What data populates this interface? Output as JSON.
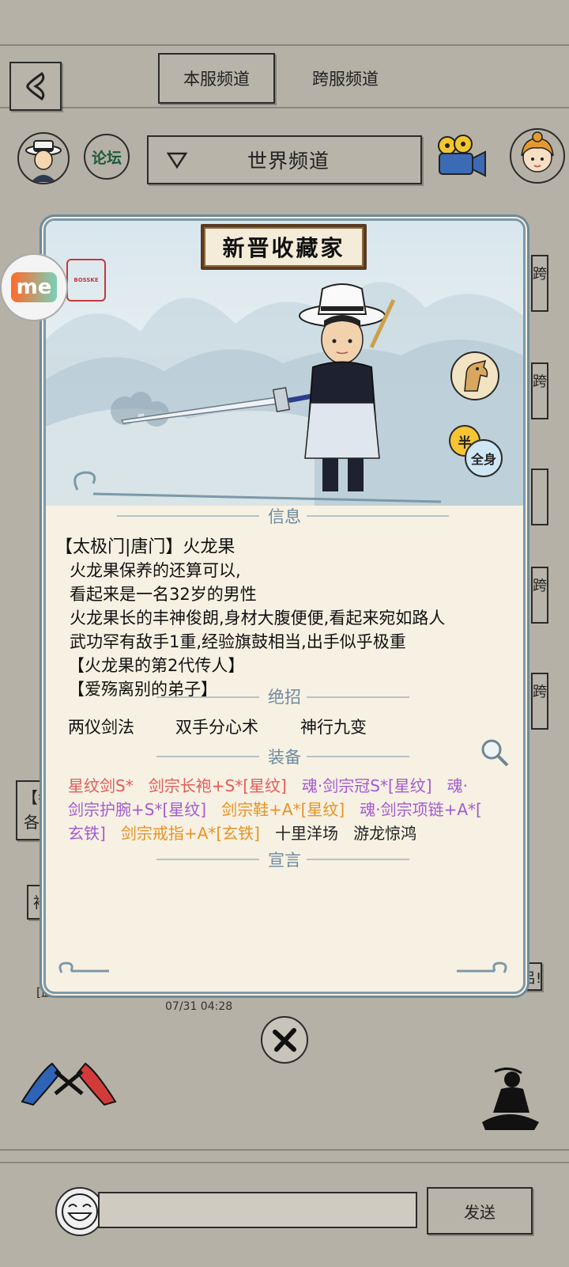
{
  "header": {
    "tabs": [
      {
        "label": "本服频道",
        "active": true
      },
      {
        "label": "跨服频道",
        "active": false
      }
    ]
  },
  "channel_bar": {
    "forum_label": "论坛",
    "channel_name": "世界频道"
  },
  "background_chat": {
    "fragment_1": "【孝",
    "fragment_2": "各",
    "fragment_3": "袖",
    "sender_fragment": "[血刀",
    "timestamp": "07/31 04:28",
    "side_char": "跨",
    "right_fragment": "吕!"
  },
  "profile": {
    "title": "新晋收藏家",
    "stance_buttons": [
      "半",
      "全身"
    ],
    "info_title": "信息",
    "name_line": "【太极门|唐门】火龙果",
    "desc_lines": [
      "火龙果保养的还算可以,",
      "看起来是一名32岁的男性",
      "火龙果长的丰神俊朗,身材大腹便便,看起来宛如路人",
      "武功罕有敌手1重,经验旗鼓相当,出手似乎极重",
      "【火龙果的第2代传人】",
      "【爱殇离别的弟子】"
    ],
    "skills_title": "绝招",
    "skills": [
      "两仪剑法",
      "双手分心术",
      "神行九变"
    ],
    "equip_title": "装备",
    "equip_lines": [
      [
        {
          "text": "星纹剑S*",
          "color": "red"
        },
        {
          "text": "剑宗长袍+S*[星纹]",
          "color": "red"
        },
        {
          "text": "魂·剑宗冠S*[星纹]",
          "color": "purple"
        },
        {
          "text": "魂·",
          "color": "purple"
        }
      ],
      [
        {
          "text": "剑宗护腕+S*[星纹]",
          "color": "purple"
        },
        {
          "text": "剑宗鞋+A*[星纹]",
          "color": "orange"
        },
        {
          "text": "魂·剑宗项链+A*[",
          "color": "purple"
        }
      ],
      [
        {
          "text": "玄铁]",
          "color": "purple"
        },
        {
          "text": "剑宗戒指+A*[玄铁]",
          "color": "orange"
        },
        {
          "text": "十里洋场",
          "color": "black"
        },
        {
          "text": "游龙惊鸿",
          "color": "black"
        }
      ]
    ],
    "manifesto_title": "宣言",
    "seal_text": "BOSSKE"
  },
  "badge": {
    "text": "me"
  },
  "footer": {
    "send_label": "发送"
  },
  "colors": {
    "background": "#b5b1a6",
    "panel": "#f7f1e3",
    "section": "#6d8aa0",
    "equip_red": "#e35b57",
    "equip_purple": "#a35ad1",
    "equip_orange": "#e79324"
  }
}
